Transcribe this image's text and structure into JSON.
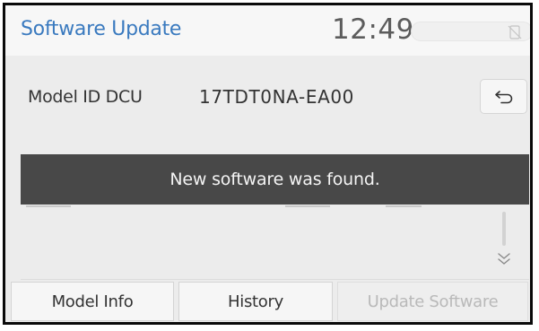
{
  "header": {
    "title": "Software Update",
    "clock": "12:49",
    "status_icon": "phone-disabled-icon"
  },
  "model": {
    "label": "Model ID DCU",
    "value": "17TDT0NA-EA00",
    "back_icon": "back-arrow-icon"
  },
  "banner": {
    "message": "New software was found."
  },
  "scroll": {
    "down_icon": "double-chevron-down-icon"
  },
  "tabs": [
    {
      "label": "Model Info",
      "enabled": true
    },
    {
      "label": "History",
      "enabled": true
    },
    {
      "label": "Update Software",
      "enabled": false
    }
  ],
  "colors": {
    "title": "#3a7abf",
    "banner_bg": "#484848",
    "banner_text": "#f4f4f4",
    "screen_bg": "#ececec",
    "disabled_text": "#b9b9b9"
  }
}
